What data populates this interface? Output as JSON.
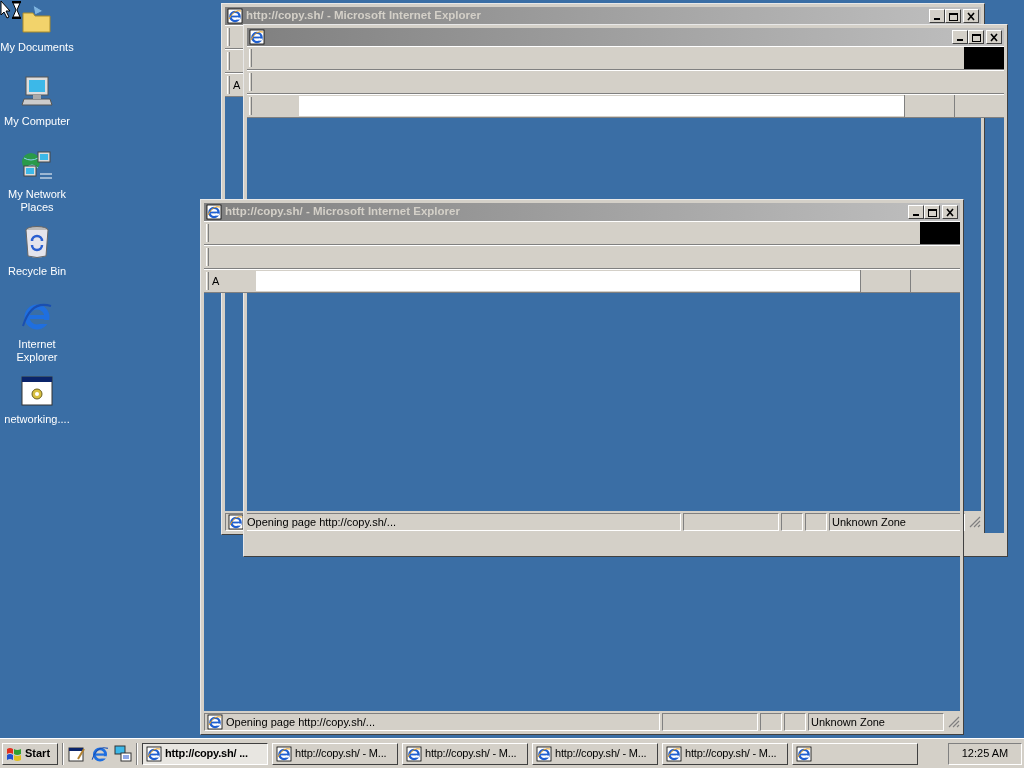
{
  "desktop_icons": [
    {
      "label": "My Documents",
      "kind": "documents"
    },
    {
      "label": "My Computer",
      "kind": "computer"
    },
    {
      "label": "My Network Places",
      "kind": "network"
    },
    {
      "label": "Recycle Bin",
      "kind": "recycle"
    },
    {
      "label": "Internet Explorer",
      "kind": "browser"
    },
    {
      "label": "networking....",
      "kind": "program"
    }
  ],
  "windows": [
    {
      "active": false,
      "title": "http://copy.sh/ - Microsoft Internet Explorer",
      "address_label": "A",
      "status": "Opening page http://copy.sh/...",
      "zone": "Unknown Zone"
    },
    {
      "active": false
    },
    {
      "active": false,
      "title": "http://copy.sh/ - Microsoft Internet Explorer",
      "address_label": "A",
      "status": "Opening page http://copy.sh/...",
      "zone": "Unknown Zone"
    }
  ],
  "taskbar": {
    "start_label": "Start",
    "tasks": [
      {
        "label": "http://copy.sh/ ...",
        "selected": true
      },
      {
        "label": "http://copy.sh/ - M...",
        "selected": false
      },
      {
        "label": "http://copy.sh/ - M...",
        "selected": false
      },
      {
        "label": "http://copy.sh/ - M...",
        "selected": false
      },
      {
        "label": "http://copy.sh/ - M...",
        "selected": false
      },
      {
        "selected": false
      }
    ],
    "clock": "12:25 AM"
  }
}
